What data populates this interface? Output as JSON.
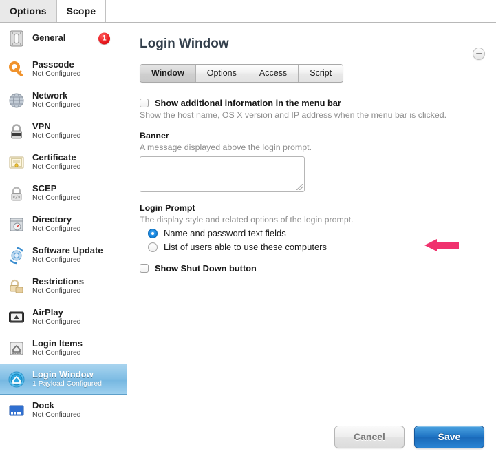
{
  "window_tabs": [
    {
      "label": "Options",
      "active": true
    },
    {
      "label": "Scope",
      "active": false
    }
  ],
  "sidebar": {
    "items": [
      {
        "title": "General",
        "sub": "",
        "icon": "switch-icon",
        "badge": "1",
        "selected": false
      },
      {
        "title": "Passcode",
        "sub": "Not Configured",
        "icon": "key-icon",
        "badge": null,
        "selected": false
      },
      {
        "title": "Network",
        "sub": "Not Configured",
        "icon": "globe-icon",
        "badge": null,
        "selected": false
      },
      {
        "title": "VPN",
        "sub": "Not Configured",
        "icon": "padlock-icon",
        "badge": null,
        "selected": false
      },
      {
        "title": "Certificate",
        "sub": "Not Configured",
        "icon": "certificate-icon",
        "badge": null,
        "selected": false
      },
      {
        "title": "SCEP",
        "sub": "Not Configured",
        "icon": "lock-code-icon",
        "badge": null,
        "selected": false
      },
      {
        "title": "Directory",
        "sub": "Not Configured",
        "icon": "directory-icon",
        "badge": null,
        "selected": false
      },
      {
        "title": "Software Update",
        "sub": "Not Configured",
        "icon": "software-update-icon",
        "badge": null,
        "selected": false
      },
      {
        "title": "Restrictions",
        "sub": "Not Configured",
        "icon": "restrictions-icon",
        "badge": null,
        "selected": false
      },
      {
        "title": "AirPlay",
        "sub": "Not Configured",
        "icon": "airplay-icon",
        "badge": null,
        "selected": false
      },
      {
        "title": "Login Items",
        "sub": "Not Configured",
        "icon": "login-items-icon",
        "badge": null,
        "selected": false
      },
      {
        "title": "Login Window",
        "sub": "1 Payload Configured",
        "icon": "login-window-icon",
        "badge": null,
        "selected": true
      },
      {
        "title": "Dock",
        "sub": "Not Configured",
        "icon": "dock-icon",
        "badge": null,
        "selected": false
      }
    ]
  },
  "pane": {
    "title": "Login Window",
    "remove_button_label": "",
    "segments": [
      {
        "label": "Window",
        "active": true
      },
      {
        "label": "Options",
        "active": false
      },
      {
        "label": "Access",
        "active": false
      },
      {
        "label": "Script",
        "active": false
      }
    ],
    "menu_bar": {
      "checkbox_label": "Show additional information in the menu bar",
      "checked": false,
      "hint": "Show the host name, OS X version and IP address when the menu bar is clicked."
    },
    "banner": {
      "label": "Banner",
      "hint": "A message displayed above the login prompt.",
      "value": "",
      "placeholder": ""
    },
    "login_prompt": {
      "label": "Login Prompt",
      "hint": "The display style and related options of the login prompt.",
      "options": [
        {
          "label": "Name and password text fields",
          "selected": true
        },
        {
          "label": "List of users able to use these computers",
          "selected": false
        }
      ]
    },
    "shut_down": {
      "checkbox_label": "Show Shut Down button",
      "checked": false
    },
    "annotation": {
      "type": "arrow-left",
      "color": "#f0326e"
    }
  },
  "footer": {
    "cancel_label": "Cancel",
    "save_label": "Save"
  },
  "colors": {
    "selection_blue": "#7fbde4",
    "save_blue": "#1f74c4",
    "badge_red": "#e8161c",
    "annotation_pink": "#f0326e",
    "title_slate": "#34404c"
  }
}
